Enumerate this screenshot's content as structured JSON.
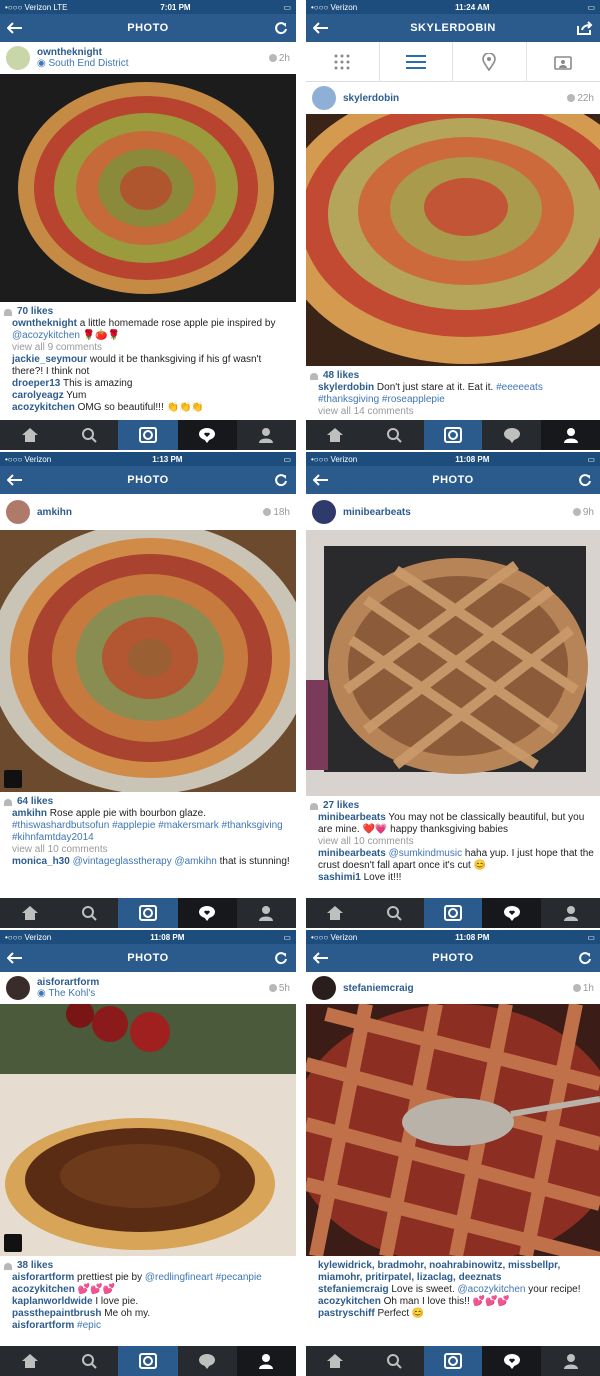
{
  "screens": [
    {
      "status": {
        "carrier": "•○○○ Verizon  LTE",
        "time": "7:01 PM"
      },
      "nav": {
        "title": "PHOTO"
      },
      "post": {
        "user": "owntheknight",
        "location": "South End District",
        "time": "2h"
      },
      "likes": "70 likes",
      "comments": [
        {
          "user": "owntheknight",
          "text": " a little homemade rose apple pie inspired by ",
          "mention": "@acozykitchen",
          "tail": " 🌹🍅🌹"
        },
        {
          "viewall": "view all 9 comments"
        },
        {
          "user": "jackie_seymour",
          "text": " would it be thanksgiving if his gf wasn't there?! I think not"
        },
        {
          "user": "droeper13",
          "text": " This is amazing"
        },
        {
          "user": "carolyeagz",
          "text": " Yum"
        },
        {
          "user": "acozykitchen",
          "text": " OMG so beautiful!!! 👏👏👏"
        }
      ],
      "photo_colors": [
        "#1c1c1c",
        "#c58a43",
        "#b8432e",
        "#9b9a3d"
      ]
    },
    {
      "status": {
        "carrier": "•○○○ Verizon",
        "time": "11:24 AM"
      },
      "nav": {
        "title": "SKYLERDOBIN"
      },
      "post": {
        "user": "skylerdobin",
        "time": "22h"
      },
      "likes": "48 likes",
      "comments": [
        {
          "user": "skylerdobin",
          "text": " Don't just stare at it. Eat it. ",
          "mention": "#eeeeeats #thanksgiving #roseapplepie"
        },
        {
          "viewall": "view all 14 comments"
        }
      ],
      "photo_colors": [
        "#3a2418",
        "#d49a50",
        "#c24a32",
        "#b5a55a"
      ]
    },
    {
      "status": {
        "carrier": "•○○○ Verizon",
        "time": "1:13 PM"
      },
      "nav": {
        "title": "PHOTO"
      },
      "post": {
        "user": "amkihn",
        "time": "18h"
      },
      "likes": "64 likes",
      "comments": [
        {
          "user": "amkihn",
          "text": " Rose apple pie with bourbon glaze. ",
          "mention": "#thiswashardbutsofun #applepie #makersmark #thanksgiving #kihnfamtday2014"
        },
        {
          "viewall": "view all 10 comments"
        },
        {
          "user": "monica_h30",
          "text": " ",
          "mention": "@vintageglasstherapy @amkihn",
          "tail": " that is stunning!"
        }
      ],
      "photo_colors": [
        "#6b4a2e",
        "#d08b48",
        "#a9432f",
        "#8a8d52"
      ]
    },
    {
      "status": {
        "carrier": "•○○○ Verizon",
        "time": "11:08 PM"
      },
      "nav": {
        "title": "PHOTO"
      },
      "post": {
        "user": "minibearbeats",
        "time": "9h"
      },
      "likes": "27 likes",
      "comments": [
        {
          "user": "minibearbeats",
          "text": " You may not be classically beautiful, but you are mine. ❤️💗 happy thanksgiving babies"
        },
        {
          "viewall": "view all 10 comments"
        },
        {
          "user": "minibearbeats",
          "text": " ",
          "mention": "@sumkindmusic",
          "tail": " haha yup. I just hope that the crust doesn't fall apart once it's cut 😊"
        },
        {
          "user": "sashimi1",
          "text": " Love it!!!"
        }
      ],
      "photo_colors": [
        "#2a2a2c",
        "#b78457",
        "#8c5c3a",
        "#d9d3cf"
      ]
    },
    {
      "status": {
        "carrier": "•○○○ Verizon",
        "time": "11:08 PM"
      },
      "nav": {
        "title": "PHOTO"
      },
      "post": {
        "user": "aisforartform",
        "location": "The Kohl's",
        "time": "5h"
      },
      "likes": "38 likes",
      "comments": [
        {
          "user": "aisforartform",
          "text": " prettiest pie by ",
          "mention": "@redlingfineart #pecanpie"
        },
        {
          "user": "acozykitchen",
          "text": " 💕💕💕"
        },
        {
          "user": "kaplanworldwide",
          "text": " I love pie."
        },
        {
          "user": "passthepaintbrush",
          "text": " Me oh my."
        },
        {
          "user": "aisforartform",
          "text": " ",
          "mention": "#epic"
        }
      ],
      "photo_colors": [
        "#e6ddd0",
        "#d8a457",
        "#5a2c14",
        "#8b1a1a"
      ]
    },
    {
      "status": {
        "carrier": "•○○○ Verizon",
        "time": "11:08 PM"
      },
      "nav": {
        "title": "PHOTO"
      },
      "post": {
        "user": "stefaniemcraig",
        "time": "1h"
      },
      "likes": "",
      "comments": [
        {
          "user": "kylewidrick, bradmohr, noahrabinowitz, missbellpr, miamohr, pritirpatel, lizaclag, deeznats",
          "text": ""
        },
        {
          "user": "stefaniemcraig",
          "text": " Love is sweet. ",
          "mention": "@acozykitchen",
          "tail": " your recipe!"
        },
        {
          "user": "acozykitchen",
          "text": " Oh man I love this!! 💕💕💕"
        },
        {
          "user": "pastryschiff",
          "text": " Perfect 😊"
        }
      ],
      "photo_colors": [
        "#3b1c16",
        "#c0714a",
        "#8c2f22",
        "#b9b2a8"
      ]
    }
  ],
  "bottom_icons": [
    "home-icon",
    "search-icon",
    "camera-icon",
    "activity-icon",
    "profile-icon"
  ],
  "colors": {
    "status_bar": "#1d4d7d",
    "nav_bar": "#2b5b8c",
    "username": "#2d5c8e",
    "bottom_bar": "#272a2f"
  }
}
